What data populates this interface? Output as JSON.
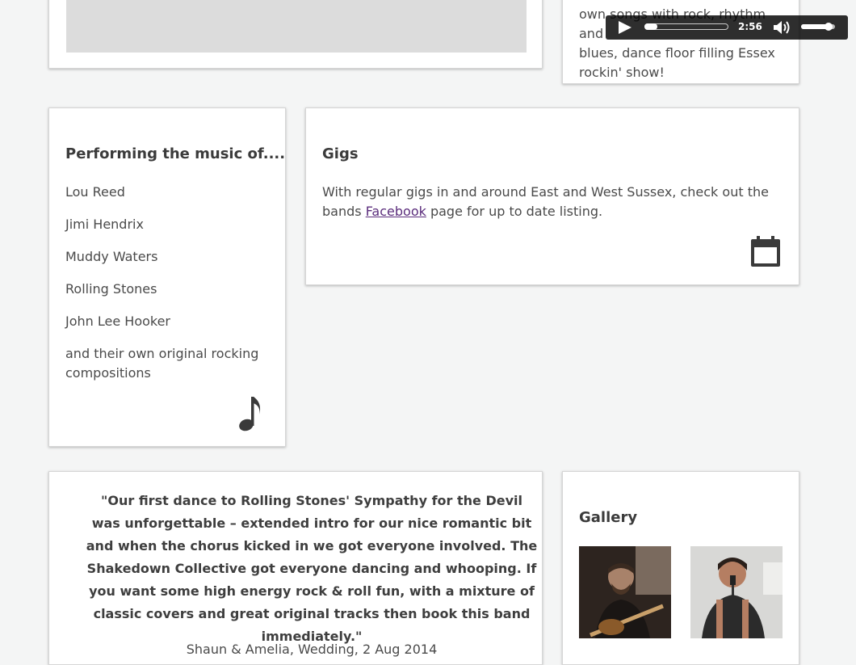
{
  "about": {
    "text_lines": [
      "own songs with rock, rhythm and",
      "blues, dance floor filling Essex",
      "rockin' show!"
    ]
  },
  "audio_player": {
    "time": "2:56",
    "progress_fraction": 0.15,
    "volume_fraction": 0.8
  },
  "performing": {
    "heading": "Performing the music of....",
    "artists": [
      "Lou Reed",
      "Jimi Hendrix",
      "Muddy Waters",
      "Rolling Stones",
      "John Lee Hooker"
    ],
    "closing": "and their own original rocking compositions",
    "icon": "music-note-icon"
  },
  "gigs": {
    "heading": "Gigs",
    "text_before": "With regular gigs in and around East and West Sussex, check out the bands ",
    "link_text": "Facebook",
    "text_after": " page for up to date listing.",
    "icon": "calendar-icon",
    "link_color": "#5b2d7c"
  },
  "testimonial": {
    "quote": "\"Our first dance to Rolling Stones' Sympathy for the Devil was unforgettable – extended intro for our nice romantic bit and when the chorus kicked in we got everyone involved. The Shakedown Collective got everyone dancing and whooping. If you want some high energy rock & roll fun, with a mixture of classic covers and great original tracks then book this band immediately.\"",
    "author": "Shaun & Amelia, Wedding, 2 Aug 2014"
  },
  "gallery": {
    "heading": "Gallery"
  }
}
